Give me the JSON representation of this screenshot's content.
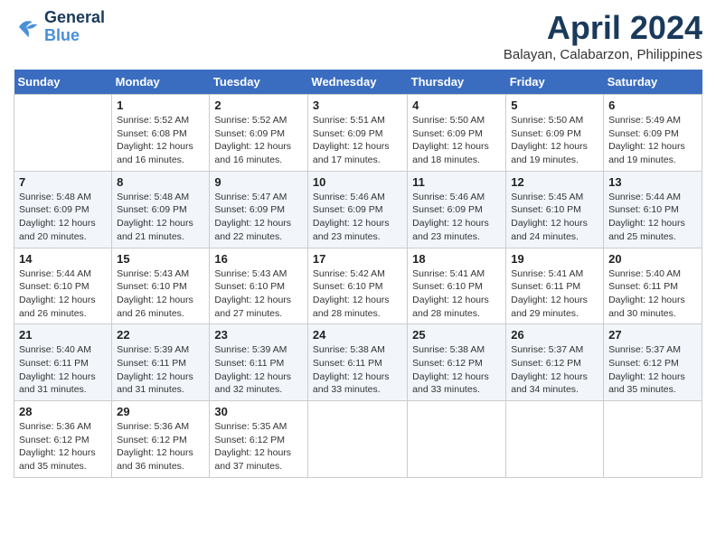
{
  "header": {
    "logo_line1": "General",
    "logo_line2": "Blue",
    "month": "April 2024",
    "location": "Balayan, Calabarzon, Philippines"
  },
  "weekdays": [
    "Sunday",
    "Monday",
    "Tuesday",
    "Wednesday",
    "Thursday",
    "Friday",
    "Saturday"
  ],
  "weeks": [
    [
      {
        "day": "",
        "info": ""
      },
      {
        "day": "1",
        "info": "Sunrise: 5:52 AM\nSunset: 6:08 PM\nDaylight: 12 hours\nand 16 minutes."
      },
      {
        "day": "2",
        "info": "Sunrise: 5:52 AM\nSunset: 6:09 PM\nDaylight: 12 hours\nand 16 minutes."
      },
      {
        "day": "3",
        "info": "Sunrise: 5:51 AM\nSunset: 6:09 PM\nDaylight: 12 hours\nand 17 minutes."
      },
      {
        "day": "4",
        "info": "Sunrise: 5:50 AM\nSunset: 6:09 PM\nDaylight: 12 hours\nand 18 minutes."
      },
      {
        "day": "5",
        "info": "Sunrise: 5:50 AM\nSunset: 6:09 PM\nDaylight: 12 hours\nand 19 minutes."
      },
      {
        "day": "6",
        "info": "Sunrise: 5:49 AM\nSunset: 6:09 PM\nDaylight: 12 hours\nand 19 minutes."
      }
    ],
    [
      {
        "day": "7",
        "info": "Sunrise: 5:48 AM\nSunset: 6:09 PM\nDaylight: 12 hours\nand 20 minutes."
      },
      {
        "day": "8",
        "info": "Sunrise: 5:48 AM\nSunset: 6:09 PM\nDaylight: 12 hours\nand 21 minutes."
      },
      {
        "day": "9",
        "info": "Sunrise: 5:47 AM\nSunset: 6:09 PM\nDaylight: 12 hours\nand 22 minutes."
      },
      {
        "day": "10",
        "info": "Sunrise: 5:46 AM\nSunset: 6:09 PM\nDaylight: 12 hours\nand 23 minutes."
      },
      {
        "day": "11",
        "info": "Sunrise: 5:46 AM\nSunset: 6:09 PM\nDaylight: 12 hours\nand 23 minutes."
      },
      {
        "day": "12",
        "info": "Sunrise: 5:45 AM\nSunset: 6:10 PM\nDaylight: 12 hours\nand 24 minutes."
      },
      {
        "day": "13",
        "info": "Sunrise: 5:44 AM\nSunset: 6:10 PM\nDaylight: 12 hours\nand 25 minutes."
      }
    ],
    [
      {
        "day": "14",
        "info": "Sunrise: 5:44 AM\nSunset: 6:10 PM\nDaylight: 12 hours\nand 26 minutes."
      },
      {
        "day": "15",
        "info": "Sunrise: 5:43 AM\nSunset: 6:10 PM\nDaylight: 12 hours\nand 26 minutes."
      },
      {
        "day": "16",
        "info": "Sunrise: 5:43 AM\nSunset: 6:10 PM\nDaylight: 12 hours\nand 27 minutes."
      },
      {
        "day": "17",
        "info": "Sunrise: 5:42 AM\nSunset: 6:10 PM\nDaylight: 12 hours\nand 28 minutes."
      },
      {
        "day": "18",
        "info": "Sunrise: 5:41 AM\nSunset: 6:10 PM\nDaylight: 12 hours\nand 28 minutes."
      },
      {
        "day": "19",
        "info": "Sunrise: 5:41 AM\nSunset: 6:11 PM\nDaylight: 12 hours\nand 29 minutes."
      },
      {
        "day": "20",
        "info": "Sunrise: 5:40 AM\nSunset: 6:11 PM\nDaylight: 12 hours\nand 30 minutes."
      }
    ],
    [
      {
        "day": "21",
        "info": "Sunrise: 5:40 AM\nSunset: 6:11 PM\nDaylight: 12 hours\nand 31 minutes."
      },
      {
        "day": "22",
        "info": "Sunrise: 5:39 AM\nSunset: 6:11 PM\nDaylight: 12 hours\nand 31 minutes."
      },
      {
        "day": "23",
        "info": "Sunrise: 5:39 AM\nSunset: 6:11 PM\nDaylight: 12 hours\nand 32 minutes."
      },
      {
        "day": "24",
        "info": "Sunrise: 5:38 AM\nSunset: 6:11 PM\nDaylight: 12 hours\nand 33 minutes."
      },
      {
        "day": "25",
        "info": "Sunrise: 5:38 AM\nSunset: 6:12 PM\nDaylight: 12 hours\nand 33 minutes."
      },
      {
        "day": "26",
        "info": "Sunrise: 5:37 AM\nSunset: 6:12 PM\nDaylight: 12 hours\nand 34 minutes."
      },
      {
        "day": "27",
        "info": "Sunrise: 5:37 AM\nSunset: 6:12 PM\nDaylight: 12 hours\nand 35 minutes."
      }
    ],
    [
      {
        "day": "28",
        "info": "Sunrise: 5:36 AM\nSunset: 6:12 PM\nDaylight: 12 hours\nand 35 minutes."
      },
      {
        "day": "29",
        "info": "Sunrise: 5:36 AM\nSunset: 6:12 PM\nDaylight: 12 hours\nand 36 minutes."
      },
      {
        "day": "30",
        "info": "Sunrise: 5:35 AM\nSunset: 6:12 PM\nDaylight: 12 hours\nand 37 minutes."
      },
      {
        "day": "",
        "info": ""
      },
      {
        "day": "",
        "info": ""
      },
      {
        "day": "",
        "info": ""
      },
      {
        "day": "",
        "info": ""
      }
    ]
  ]
}
